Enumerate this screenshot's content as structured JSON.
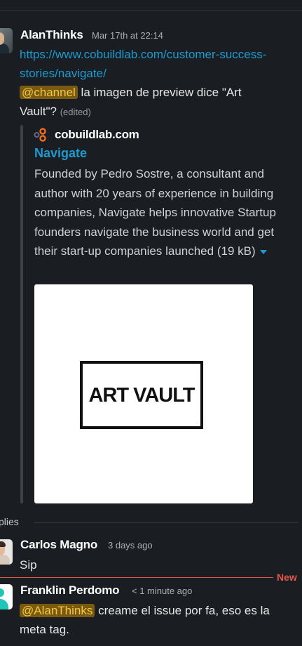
{
  "message": {
    "author": "AlanThinks",
    "timestamp": "Mar 17th at 22:14",
    "link_line1": "https://www.cobuildlab.com/customer-success-",
    "link_line2": "stories/navigate/",
    "mention": "@channel",
    "text_part1": " la imagen de preview dice \"Art",
    "text_part2": "Vault\"?",
    "edited": "(edited)"
  },
  "attachment": {
    "site_icon": "cobuildlab-logo-icon",
    "site_name": "cobuildlab.com",
    "title": "Navigate",
    "description": "Founded by Pedro Sostre, a consultant and author with 20 years of experience in building companies, Navigate helps innovative Startup founders navigate the business world and get their start-up companies launched",
    "size": "(19 kB)",
    "image_text": "ART VAULT"
  },
  "replies": {
    "label": "plies"
  },
  "reply1": {
    "author": "Carlos Magno",
    "time": "3 days ago",
    "text": "Sip"
  },
  "divider": {
    "label": "New",
    "color": "#e0584a"
  },
  "reply2": {
    "author": "Franklin Perdomo",
    "time": "< 1 minute ago",
    "mention": "@AlanThinks",
    "text_line1": " creame el issue por fa, eso es la",
    "text_line2": "meta tag."
  },
  "colors": {
    "background": "#1a1d21",
    "link": "#1d9bd1",
    "mention_bg": "#7a5a10",
    "mention_text": "#f2c744"
  }
}
